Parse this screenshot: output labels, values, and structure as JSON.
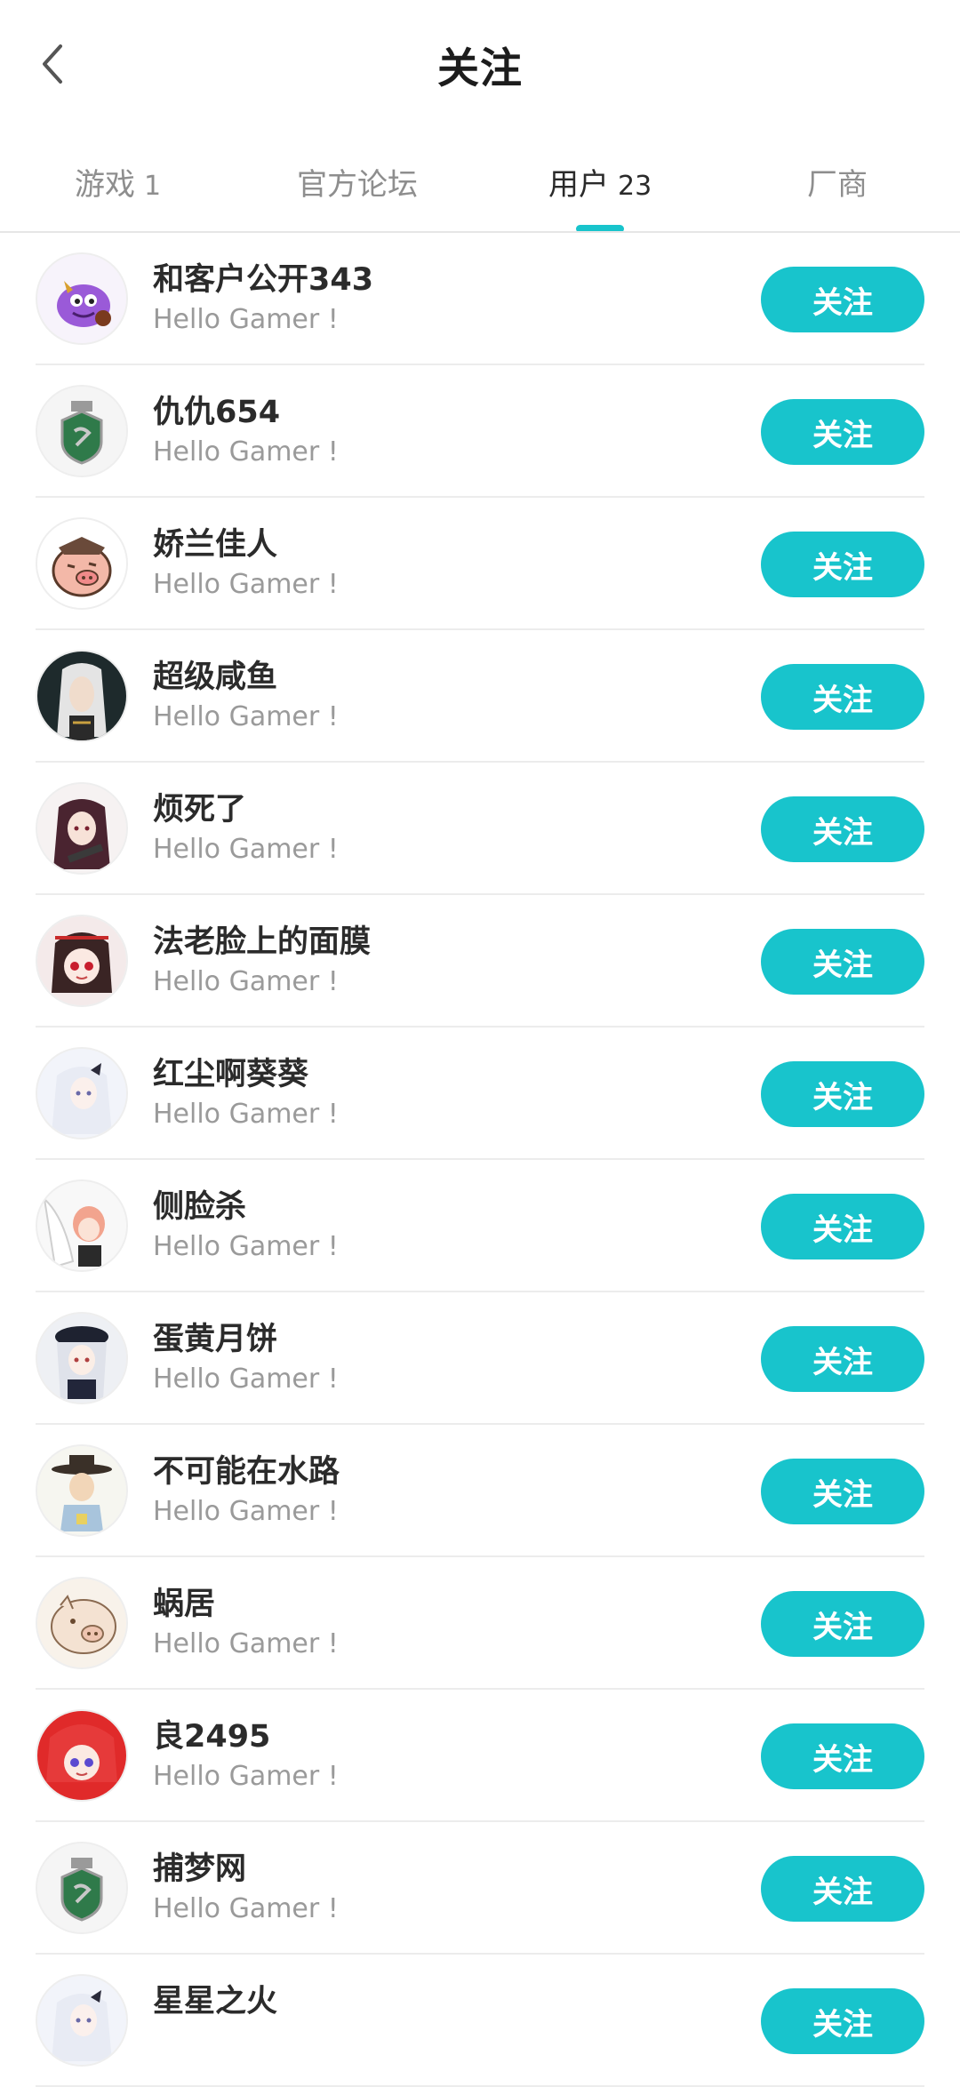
{
  "header": {
    "title": "关注",
    "back_icon": "chevron-left-icon"
  },
  "tabs": [
    {
      "label": "游戏",
      "count": "1",
      "active": false
    },
    {
      "label": "官方论坛",
      "count": "",
      "active": false
    },
    {
      "label": "用户",
      "count": "23",
      "active": true
    },
    {
      "label": "厂商",
      "count": "",
      "active": false
    }
  ],
  "accent_color": "#18c4cc",
  "users": [
    {
      "name": "和客户公开343",
      "bio": "Hello Gamer !",
      "button": "关注",
      "avatar": "purple-monster-avatar"
    },
    {
      "name": "仇仇654",
      "bio": "Hello Gamer !",
      "button": "关注",
      "avatar": "green-crest-avatar"
    },
    {
      "name": "娇兰佳人",
      "bio": "Hello Gamer !",
      "button": "关注",
      "avatar": "pig-warrior-avatar"
    },
    {
      "name": "超级咸鱼",
      "bio": "Hello Gamer !",
      "button": "关注",
      "avatar": "white-haired-man-avatar"
    },
    {
      "name": "烦死了",
      "bio": "Hello Gamer !",
      "button": "关注",
      "avatar": "dark-haired-girl-avatar"
    },
    {
      "name": "法老脸上的面膜",
      "bio": "Hello Gamer !",
      "button": "关注",
      "avatar": "red-eyed-girl-avatar"
    },
    {
      "name": "红尘啊葵葵",
      "bio": "Hello Gamer !",
      "button": "关注",
      "avatar": "white-haired-girl-avatar"
    },
    {
      "name": "侧脸杀",
      "bio": "Hello Gamer !",
      "button": "关注",
      "avatar": "pink-haired-girl-avatar"
    },
    {
      "name": "蛋黄月饼",
      "bio": "Hello Gamer !",
      "button": "关注",
      "avatar": "beret-girl-avatar"
    },
    {
      "name": "不可能在水路",
      "bio": "Hello Gamer !",
      "button": "关注",
      "avatar": "hat-man-avatar"
    },
    {
      "name": "蜗居",
      "bio": "Hello Gamer !",
      "button": "关注",
      "avatar": "pig-sketch-avatar"
    },
    {
      "name": "良2495",
      "bio": "Hello Gamer !",
      "button": "关注",
      "avatar": "red-haired-girl-avatar"
    },
    {
      "name": "捕梦网",
      "bio": "Hello Gamer !",
      "button": "关注",
      "avatar": "green-crest-avatar"
    },
    {
      "name": "星星之火",
      "bio": "",
      "button": "关注",
      "avatar": "white-haired-girl-avatar"
    }
  ]
}
